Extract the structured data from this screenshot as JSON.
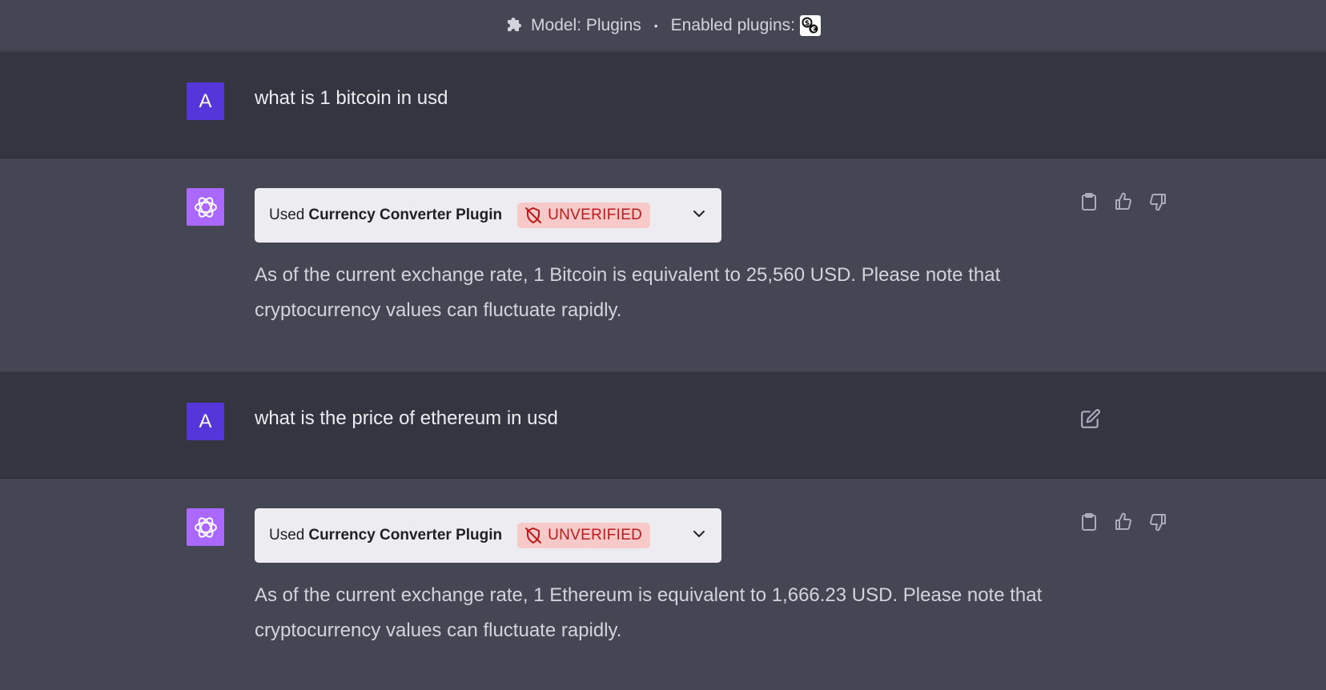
{
  "topbar": {
    "model_label": "Model: Plugins",
    "separator": "•",
    "enabled_label": "Enabled plugins:",
    "plugin_logo_icon": "currency-converter-logo"
  },
  "messages": [
    {
      "role": "user",
      "avatar": "A",
      "text": "what is 1 bitcoin in usd"
    },
    {
      "role": "assistant",
      "plugin": {
        "used_label": "Used",
        "name": "Currency Converter Plugin",
        "badge": "UNVERIFIED"
      },
      "text": "As of the current exchange rate, 1 Bitcoin is equivalent to 25,560 USD. Please note that cryptocurrency values can fluctuate rapidly."
    },
    {
      "role": "user",
      "avatar": "A",
      "text": "what is the price of ethereum in usd"
    },
    {
      "role": "assistant",
      "plugin": {
        "used_label": "Used",
        "name": "Currency Converter Plugin",
        "badge": "UNVERIFIED"
      },
      "text": "As of the current exchange rate, 1 Ethereum is equivalent to 1,666.23 USD. Please note that cryptocurrency values can fluctuate rapidly."
    }
  ],
  "colors": {
    "user_row_bg": "#343541",
    "bot_row_bg": "#444654",
    "user_avatar": "#5436da",
    "bot_avatar": "#ab68ff",
    "badge_bg": "#f8c9c9",
    "badge_text": "#b91c1c"
  }
}
